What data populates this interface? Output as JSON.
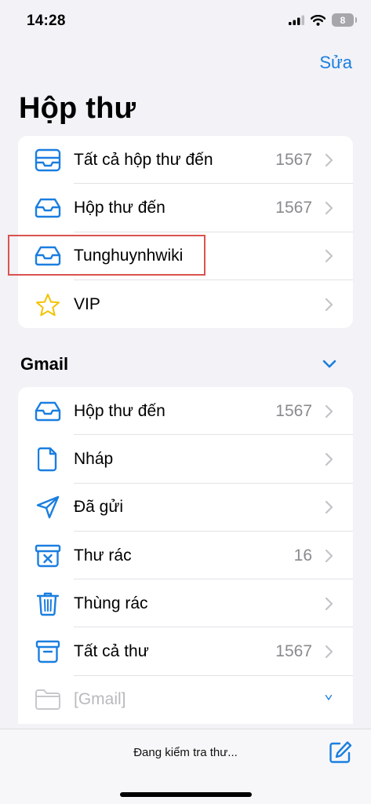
{
  "status_bar": {
    "time": "14:28",
    "battery_level": "8",
    "icons": [
      "signal-icon",
      "wifi-icon",
      "battery-icon"
    ]
  },
  "header": {
    "edit_label": "Sửa",
    "title": "Hộp thư"
  },
  "mailboxes": [
    {
      "label": "Tất cả hộp thư đến",
      "count": "1567",
      "icon": "all-inboxes-icon"
    },
    {
      "label": "Hộp thư đến",
      "count": "1567",
      "icon": "inbox-icon"
    },
    {
      "label": "Tunghuynhwiki",
      "count": "",
      "icon": "inbox-icon",
      "highlighted": true
    },
    {
      "label": "VIP",
      "count": "",
      "icon": "star-icon"
    }
  ],
  "gmail_section": {
    "title": "Gmail",
    "expanded": true,
    "items": [
      {
        "label": "Hộp thư đến",
        "count": "1567",
        "icon": "inbox-icon"
      },
      {
        "label": "Nháp",
        "count": "",
        "icon": "draft-icon"
      },
      {
        "label": "Đã gửi",
        "count": "",
        "icon": "sent-icon"
      },
      {
        "label": "Thư rác",
        "count": "16",
        "icon": "junk-icon"
      },
      {
        "label": "Thùng rác",
        "count": "",
        "icon": "trash-icon"
      },
      {
        "label": "Tất cả thư",
        "count": "1567",
        "icon": "archive-icon"
      },
      {
        "label": "[Gmail]",
        "count": "",
        "icon": "folder-icon",
        "disabled": true
      }
    ]
  },
  "toolbar": {
    "status_text": "Đang kiểm tra thư..."
  },
  "colors": {
    "accent": "#1a7ee0",
    "star": "#f2c200",
    "background": "#f2f2f7",
    "highlight_border": "#d9534f"
  }
}
